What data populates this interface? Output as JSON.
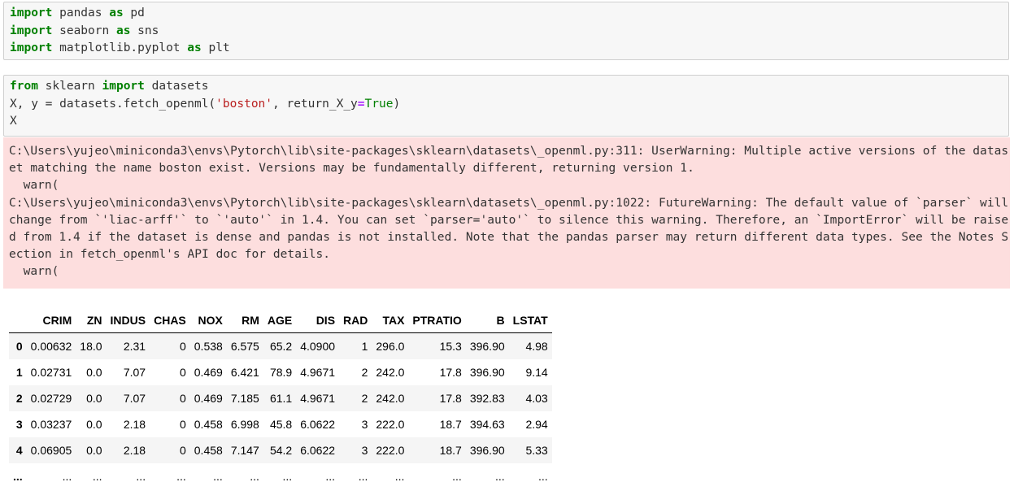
{
  "cell1": {
    "lines": [
      {
        "kw1": "import",
        "mod": " pandas ",
        "kw2": "as",
        "alias": " pd"
      },
      {
        "kw1": "import",
        "mod": " seaborn ",
        "kw2": "as",
        "alias": " sns"
      },
      {
        "kw1": "import",
        "mod": " matplotlib.pyplot ",
        "kw2": "as",
        "alias": " plt"
      }
    ]
  },
  "cell2": {
    "line1": {
      "kw1": "from",
      "mod": " sklearn ",
      "kw2": "import",
      "rest": " datasets"
    },
    "line2": {
      "pre": "X, y = datasets.fetch_openml(",
      "str": "'boston'",
      "mid": ", return_X_y",
      "op": "=",
      "val": "True",
      "post": ")"
    },
    "line3": "X"
  },
  "stderr": "C:\\Users\\yujeo\\miniconda3\\envs\\Pytorch\\lib\\site-packages\\sklearn\\datasets\\_openml.py:311: UserWarning: Multiple active versions of the dataset matching the name boston exist. Versions may be fundamentally different, returning version 1.\n  warn(\nC:\\Users\\yujeo\\miniconda3\\envs\\Pytorch\\lib\\site-packages\\sklearn\\datasets\\_openml.py:1022: FutureWarning: The default value of `parser` will change from `'liac-arff'` to `'auto'` in 1.4. You can set `parser='auto'` to silence this warning. Therefore, an `ImportError` will be raised from 1.4 if the dataset is dense and pandas is not installed. Note that the pandas parser may return different data types. See the Notes Section in fetch_openml's API doc for details.\n  warn(",
  "dataframe": {
    "columns": [
      "",
      "CRIM",
      "ZN",
      "INDUS",
      "CHAS",
      "NOX",
      "RM",
      "AGE",
      "DIS",
      "RAD",
      "TAX",
      "PTRATIO",
      "B",
      "LSTAT"
    ],
    "rows": [
      [
        "0",
        "0.00632",
        "18.0",
        "2.31",
        "0",
        "0.538",
        "6.575",
        "65.2",
        "4.0900",
        "1",
        "296.0",
        "15.3",
        "396.90",
        "4.98"
      ],
      [
        "1",
        "0.02731",
        "0.0",
        "7.07",
        "0",
        "0.469",
        "6.421",
        "78.9",
        "4.9671",
        "2",
        "242.0",
        "17.8",
        "396.90",
        "9.14"
      ],
      [
        "2",
        "0.02729",
        "0.0",
        "7.07",
        "0",
        "0.469",
        "7.185",
        "61.1",
        "4.9671",
        "2",
        "242.0",
        "17.8",
        "392.83",
        "4.03"
      ],
      [
        "3",
        "0.03237",
        "0.0",
        "2.18",
        "0",
        "0.458",
        "6.998",
        "45.8",
        "6.0622",
        "3",
        "222.0",
        "18.7",
        "394.63",
        "2.94"
      ],
      [
        "4",
        "0.06905",
        "0.0",
        "2.18",
        "0",
        "0.458",
        "7.147",
        "54.2",
        "6.0622",
        "3",
        "222.0",
        "18.7",
        "396.90",
        "5.33"
      ],
      [
        "...",
        "...",
        "...",
        "...",
        "...",
        "...",
        "...",
        "...",
        "...",
        "...",
        "...",
        "...",
        "...",
        "..."
      ]
    ]
  }
}
